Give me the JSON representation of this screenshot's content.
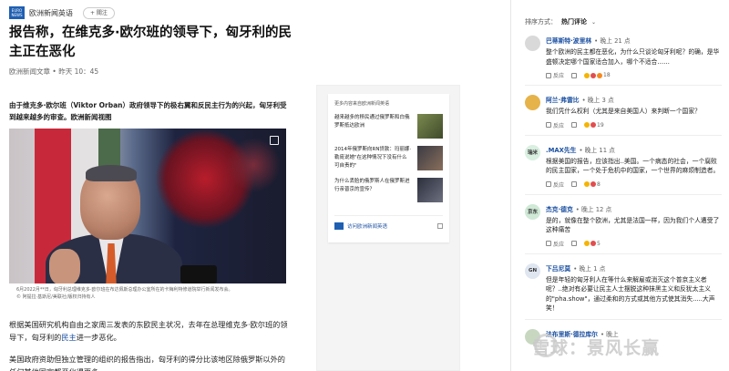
{
  "header": {
    "source_logo_text": "EURO NEWS",
    "source_name": "欧洲新闻英语",
    "follow_label": "+ 關注"
  },
  "article": {
    "title": "报告称，在维克多·欧尔班的领导下，匈牙利的民主正在恶化",
    "meta": "欧洲新闻文章 • 昨天 10：45",
    "lead": "由于维克多·欧尔班（Viktor Orban）政府领导下的极右翼和反民主行为的兴起，匈牙利受到越来越多的审查。欧洲新闻视图",
    "photo_caption": "6月2022月**日，匈牙利总理维克多·欧尔班在布达佩斯总理办公室所在的卡梅利特修道院举行新闻发布会。",
    "photo_credit": "© 阿提拉·基斯尼/美联社/版权归持有人",
    "para1_a": "根据美国研究机构自由之家周三发表的东欧民主状况，去年在总理维克多·欧尔班的领导下，匈牙利的",
    "para1_link": "民主",
    "para1_b": "进一步恶化。",
    "para2": "美国政府资助但独立管理的组织的报告指出，匈牙利的得分比该地区除俄罗斯以外的任何其他国家都恶化得更多。"
  },
  "related": {
    "header": "更多内容来自欧洲新闻英语",
    "items": [
      {
        "text": "越来越多的移民通过俄罗斯和白俄罗斯抵达欧洲"
      },
      {
        "text": "2014年俄罗斯向RN贷款：玛丽娜·勒庞说她\"在这种情况下没有什么可自责的\""
      },
      {
        "text": "为什么丢脸的俄罗斯人在俄罗斯进行亲普京的宣传？"
      }
    ],
    "footer": "访问欧洲新闻英语"
  },
  "comments": {
    "sort_label": "排序方式：",
    "sort_value": "热门评论",
    "items": [
      {
        "name": "巴蒂斯特·波里林",
        "time": "• 晚上 21 点",
        "text": "整个欧洲的民主都在恶化，为什么只谈论匈牙利呢？的确，是华盛顿决定哪个国家适合加入，哪个不适合……",
        "reply": "反应",
        "count": "18",
        "avatar": "",
        "avatar_color": "#d9d9d9"
      },
      {
        "name": "阿兰·弗雷比",
        "time": "• 晚上 3 点",
        "text": "我们凭什么权利（尤其是来自美国人）来判断一个国家？",
        "reply": "反应",
        "count": "19",
        "avatar": "",
        "avatar_color": "#e6b34a"
      },
      {
        "name": ".MAX先生",
        "time": "• 晚上 11 点",
        "text": "根据美国的报告，应该指出..美国。一个病态的社会，一个腐败的民主国家，一个处于危机中的国家，一个世界的麻烦制造者。",
        "reply": "反应",
        "count": "8",
        "avatar": "瑞米",
        "avatar_color": "#d9efe0"
      },
      {
        "name": "杰克·德克",
        "time": "• 晚上 12 点",
        "text": "是的，就像在整个欧洲，尤其是法国一样，因为我们个人遭受了这种痛苦",
        "reply": "反应",
        "count": "5",
        "avatar": "京东",
        "avatar_color": "#cfe9d6"
      },
      {
        "name": "下吕尼莫",
        "time": "• 晚上 1 点",
        "text": "但是年轻的匈牙利人在等什么来解雇或消灭这个普京主义者呢？..绝对有必要让民主人士摆脱这种抹黑主义和反犹太主义的\"pha.show\"，通过柔和的方式或其他方式使其消失.....大声笑！",
        "reply": "反应",
        "count": "",
        "avatar": "GN",
        "avatar_color": "#dfe6f0"
      },
      {
        "name": "法布里斯·德拉库尔",
        "time": "• 晚上",
        "text": "",
        "reply": "",
        "count": "",
        "avatar": "",
        "avatar_color": "#c8d8c0"
      }
    ]
  },
  "watermark": "雪球：景风长赢"
}
